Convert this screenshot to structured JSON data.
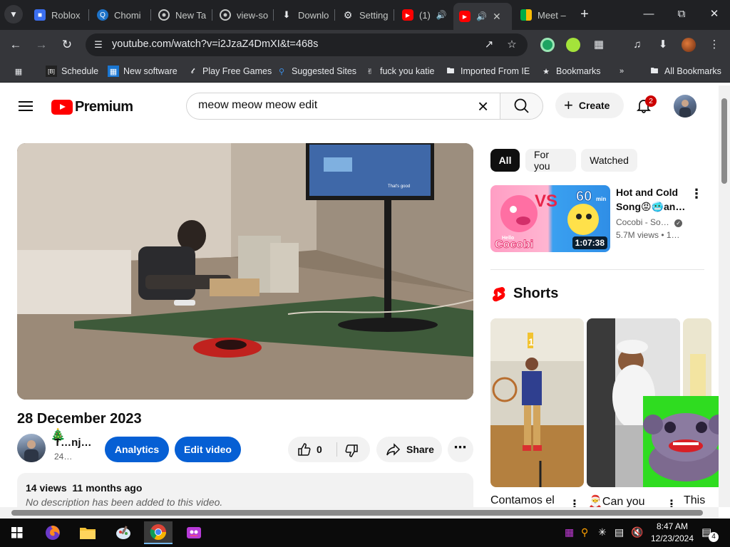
{
  "browser": {
    "tabs": [
      {
        "label": "Roblox",
        "icon": "roblox-icon",
        "color": "#3b6ff0"
      },
      {
        "label": "Chomi",
        "icon": "chomi-icon",
        "color": "#4a90e2"
      },
      {
        "label": "New Ta",
        "icon": "chrome-icon",
        "color": "#9aa0a6"
      },
      {
        "label": "view-so",
        "icon": "chrome-icon",
        "color": "#9aa0a6"
      },
      {
        "label": "Downlo",
        "icon": "download-icon",
        "color": "#e8eaed"
      },
      {
        "label": "Setting",
        "icon": "gear-icon",
        "color": "#e8eaed"
      },
      {
        "label": "(1)",
        "icon": "youtube-icon",
        "color": "#ff0000"
      },
      {
        "label": "",
        "icon": "youtube-icon",
        "color": "#ff0000"
      },
      {
        "label": "Meet –",
        "icon": "meet-icon",
        "color": "#00ac47"
      }
    ],
    "url": "youtube.com/watch?v=i2JzaZ4DmXI&t=468s",
    "bookmarks": [
      {
        "label": "Schedule",
        "icon": "schedule-icon"
      },
      {
        "label": "New software",
        "icon": "software-icon"
      },
      {
        "label": "Play Free Games",
        "icon": "games-icon"
      },
      {
        "label": "Suggested Sites",
        "icon": "suggested-icon"
      },
      {
        "label": "fuck you katie",
        "icon": "bookmark-hand-icon"
      },
      {
        "label": "Imported From IE",
        "icon": "folder-icon"
      },
      {
        "label": "Bookmarks",
        "icon": "star-icon"
      }
    ],
    "all_bookmarks": "All Bookmarks"
  },
  "youtube": {
    "logo_text": "Premium",
    "search_query": "meow meow meow edit",
    "create_label": "Create",
    "notification_count": "2",
    "video": {
      "title": "28 December 2023",
      "channel": "T…nj…",
      "subs": "24…",
      "analytics_label": "Analytics",
      "edit_label": "Edit video",
      "likes": "0",
      "share_label": "Share",
      "views": "14 views",
      "age": "11 months ago",
      "description": "No description has been added to this video.",
      "overlay_caption": "That's good"
    },
    "chips": [
      "All",
      "For you",
      "Watched"
    ],
    "recommendation": {
      "title": "Hot and Cold Song😡🥶an…",
      "channel": "Cocobi - So…",
      "meta": "5.7M views • 1…",
      "duration": "1:07:38",
      "thumb_vs": "VS",
      "thumb_60": "60",
      "thumb_min": "min",
      "thumb_brand": "Cocobi",
      "thumb_hello": "Hello"
    },
    "shorts_title": "Shorts",
    "shorts": [
      {
        "title": "Contamos el"
      },
      {
        "title": "🎅Can you"
      },
      {
        "title": "This"
      }
    ],
    "shorts_overlay_number": "1"
  },
  "taskbar": {
    "time": "8:47 AM",
    "date": "12/23/2024",
    "notifications": "4"
  }
}
